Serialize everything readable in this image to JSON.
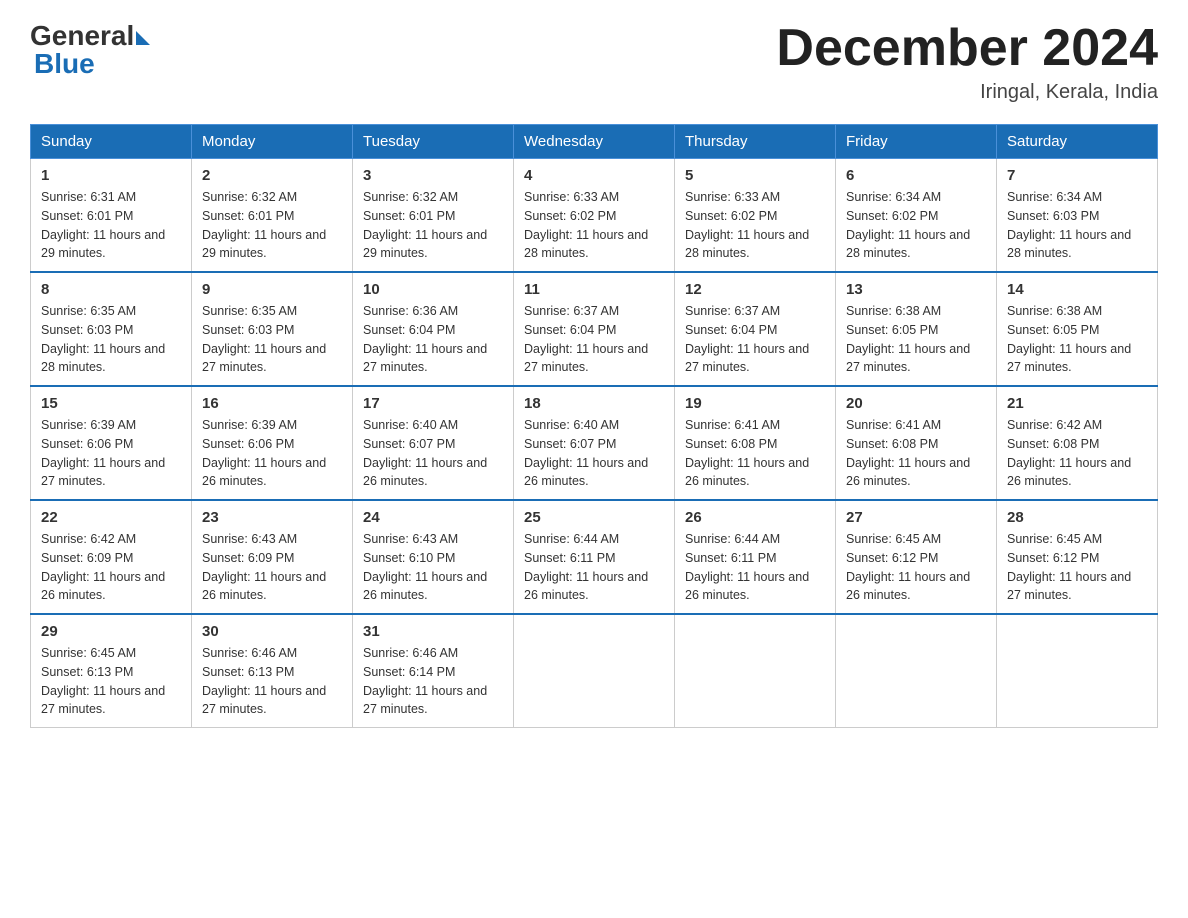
{
  "header": {
    "logo_general": "General",
    "logo_blue": "Blue",
    "month_title": "December 2024",
    "location": "Iringal, Kerala, India"
  },
  "days_of_week": [
    "Sunday",
    "Monday",
    "Tuesday",
    "Wednesday",
    "Thursday",
    "Friday",
    "Saturday"
  ],
  "weeks": [
    [
      {
        "num": "1",
        "sunrise": "6:31 AM",
        "sunset": "6:01 PM",
        "daylight": "11 hours and 29 minutes."
      },
      {
        "num": "2",
        "sunrise": "6:32 AM",
        "sunset": "6:01 PM",
        "daylight": "11 hours and 29 minutes."
      },
      {
        "num": "3",
        "sunrise": "6:32 AM",
        "sunset": "6:01 PM",
        "daylight": "11 hours and 29 minutes."
      },
      {
        "num": "4",
        "sunrise": "6:33 AM",
        "sunset": "6:02 PM",
        "daylight": "11 hours and 28 minutes."
      },
      {
        "num": "5",
        "sunrise": "6:33 AM",
        "sunset": "6:02 PM",
        "daylight": "11 hours and 28 minutes."
      },
      {
        "num": "6",
        "sunrise": "6:34 AM",
        "sunset": "6:02 PM",
        "daylight": "11 hours and 28 minutes."
      },
      {
        "num": "7",
        "sunrise": "6:34 AM",
        "sunset": "6:03 PM",
        "daylight": "11 hours and 28 minutes."
      }
    ],
    [
      {
        "num": "8",
        "sunrise": "6:35 AM",
        "sunset": "6:03 PM",
        "daylight": "11 hours and 28 minutes."
      },
      {
        "num": "9",
        "sunrise": "6:35 AM",
        "sunset": "6:03 PM",
        "daylight": "11 hours and 27 minutes."
      },
      {
        "num": "10",
        "sunrise": "6:36 AM",
        "sunset": "6:04 PM",
        "daylight": "11 hours and 27 minutes."
      },
      {
        "num": "11",
        "sunrise": "6:37 AM",
        "sunset": "6:04 PM",
        "daylight": "11 hours and 27 minutes."
      },
      {
        "num": "12",
        "sunrise": "6:37 AM",
        "sunset": "6:04 PM",
        "daylight": "11 hours and 27 minutes."
      },
      {
        "num": "13",
        "sunrise": "6:38 AM",
        "sunset": "6:05 PM",
        "daylight": "11 hours and 27 minutes."
      },
      {
        "num": "14",
        "sunrise": "6:38 AM",
        "sunset": "6:05 PM",
        "daylight": "11 hours and 27 minutes."
      }
    ],
    [
      {
        "num": "15",
        "sunrise": "6:39 AM",
        "sunset": "6:06 PM",
        "daylight": "11 hours and 27 minutes."
      },
      {
        "num": "16",
        "sunrise": "6:39 AM",
        "sunset": "6:06 PM",
        "daylight": "11 hours and 26 minutes."
      },
      {
        "num": "17",
        "sunrise": "6:40 AM",
        "sunset": "6:07 PM",
        "daylight": "11 hours and 26 minutes."
      },
      {
        "num": "18",
        "sunrise": "6:40 AM",
        "sunset": "6:07 PM",
        "daylight": "11 hours and 26 minutes."
      },
      {
        "num": "19",
        "sunrise": "6:41 AM",
        "sunset": "6:08 PM",
        "daylight": "11 hours and 26 minutes."
      },
      {
        "num": "20",
        "sunrise": "6:41 AM",
        "sunset": "6:08 PM",
        "daylight": "11 hours and 26 minutes."
      },
      {
        "num": "21",
        "sunrise": "6:42 AM",
        "sunset": "6:08 PM",
        "daylight": "11 hours and 26 minutes."
      }
    ],
    [
      {
        "num": "22",
        "sunrise": "6:42 AM",
        "sunset": "6:09 PM",
        "daylight": "11 hours and 26 minutes."
      },
      {
        "num": "23",
        "sunrise": "6:43 AM",
        "sunset": "6:09 PM",
        "daylight": "11 hours and 26 minutes."
      },
      {
        "num": "24",
        "sunrise": "6:43 AM",
        "sunset": "6:10 PM",
        "daylight": "11 hours and 26 minutes."
      },
      {
        "num": "25",
        "sunrise": "6:44 AM",
        "sunset": "6:11 PM",
        "daylight": "11 hours and 26 minutes."
      },
      {
        "num": "26",
        "sunrise": "6:44 AM",
        "sunset": "6:11 PM",
        "daylight": "11 hours and 26 minutes."
      },
      {
        "num": "27",
        "sunrise": "6:45 AM",
        "sunset": "6:12 PM",
        "daylight": "11 hours and 26 minutes."
      },
      {
        "num": "28",
        "sunrise": "6:45 AM",
        "sunset": "6:12 PM",
        "daylight": "11 hours and 27 minutes."
      }
    ],
    [
      {
        "num": "29",
        "sunrise": "6:45 AM",
        "sunset": "6:13 PM",
        "daylight": "11 hours and 27 minutes."
      },
      {
        "num": "30",
        "sunrise": "6:46 AM",
        "sunset": "6:13 PM",
        "daylight": "11 hours and 27 minutes."
      },
      {
        "num": "31",
        "sunrise": "6:46 AM",
        "sunset": "6:14 PM",
        "daylight": "11 hours and 27 minutes."
      },
      null,
      null,
      null,
      null
    ]
  ],
  "labels": {
    "sunrise": "Sunrise:",
    "sunset": "Sunset:",
    "daylight": "Daylight:"
  }
}
